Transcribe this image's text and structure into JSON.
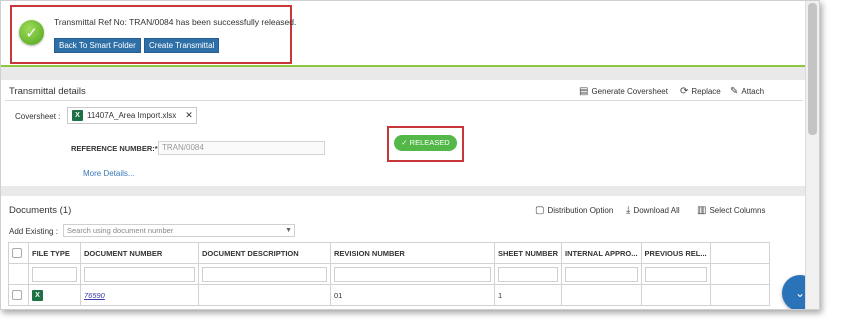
{
  "success": {
    "message": "Transmittal Ref No: TRAN/0084 has been successfully released.",
    "back_button": "Back To Smart Folder",
    "create_button": "Create Transmittal"
  },
  "transmittal": {
    "title": "Transmittal details",
    "toolbar": {
      "generate": "Generate Coversheet",
      "replace": "Replace",
      "attach": "Attach"
    },
    "coversheet_label": "Coversheet :",
    "coversheet_file": "11407A_Area Import.xlsx",
    "reference_label": "REFERENCE NUMBER:*",
    "reference_value": "TRAN/0084",
    "status": "RELEASED",
    "more_details": "More Details..."
  },
  "documents": {
    "title": "Documents (1)",
    "toolbar": {
      "distribution": "Distribution Option",
      "download_all": "Download All",
      "select_columns": "Select Columns"
    },
    "add_existing_label": "Add Existing :",
    "search_placeholder": "Search using document number",
    "columns": [
      "FILE TYPE",
      "DOCUMENT NUMBER",
      "DOCUMENT DESCRIPTION",
      "REVISION NUMBER",
      "SHEET NUMBER",
      "INTERNAL APPRO...",
      "PREVIOUS REL..."
    ],
    "rows": [
      {
        "document_number": "76590",
        "description": "",
        "revision": "01",
        "sheet": "1",
        "internal": "",
        "previous": ""
      }
    ]
  },
  "icons": {
    "success": "check-circle-icon",
    "fab": "chevron-down-icon"
  },
  "colors": {
    "primary_button": "#2f6fa8",
    "released": "#54b848",
    "highlight_border": "#c9373b",
    "success_rule": "#8dc63f"
  }
}
